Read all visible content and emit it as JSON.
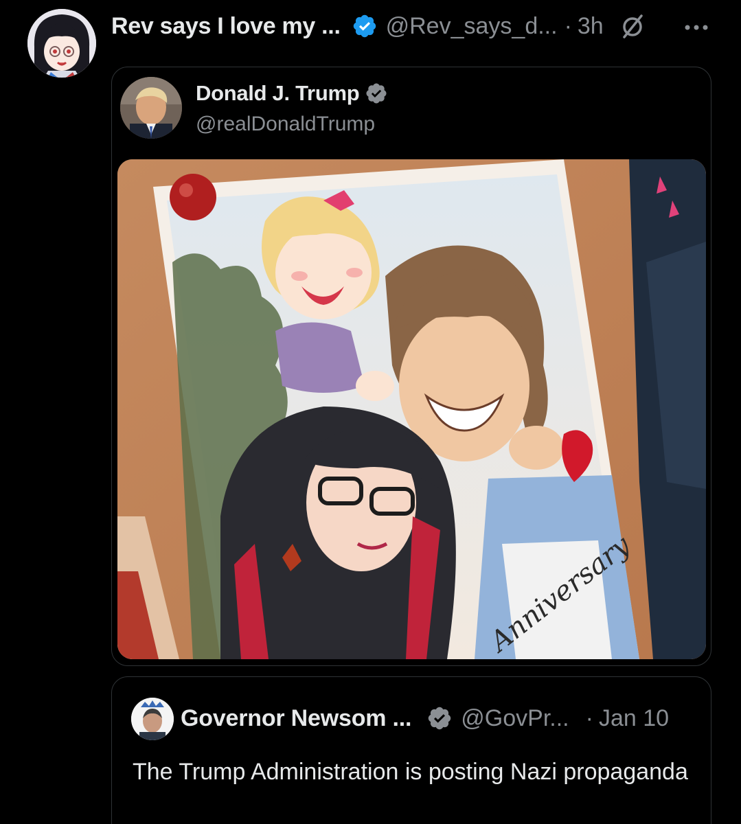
{
  "post": {
    "display_name": "Rev says I love my ...",
    "handle": "@Rev_says_d...",
    "separator": "·",
    "time": "3h"
  },
  "quoted_post": {
    "display_name": "Donald J. Trump",
    "handle": "@realDonaldTrump",
    "image_signature": "Anniversary"
  },
  "second_quoted_post": {
    "display_name": "Governor Newsom ...",
    "handle": "@GovPr...",
    "separator": "·",
    "date": "Jan 10",
    "text": "The Trump Administration is posting Nazi propaganda"
  },
  "colors": {
    "background": "#000000",
    "verified_blue": "#1d9bf0",
    "text_primary": "#e7e9ea",
    "text_secondary": "#8b8f94",
    "border": "#2f3336"
  },
  "icons": {
    "verified": "verified-badge-icon",
    "mute": "mute-icon",
    "more": "more-icon"
  }
}
